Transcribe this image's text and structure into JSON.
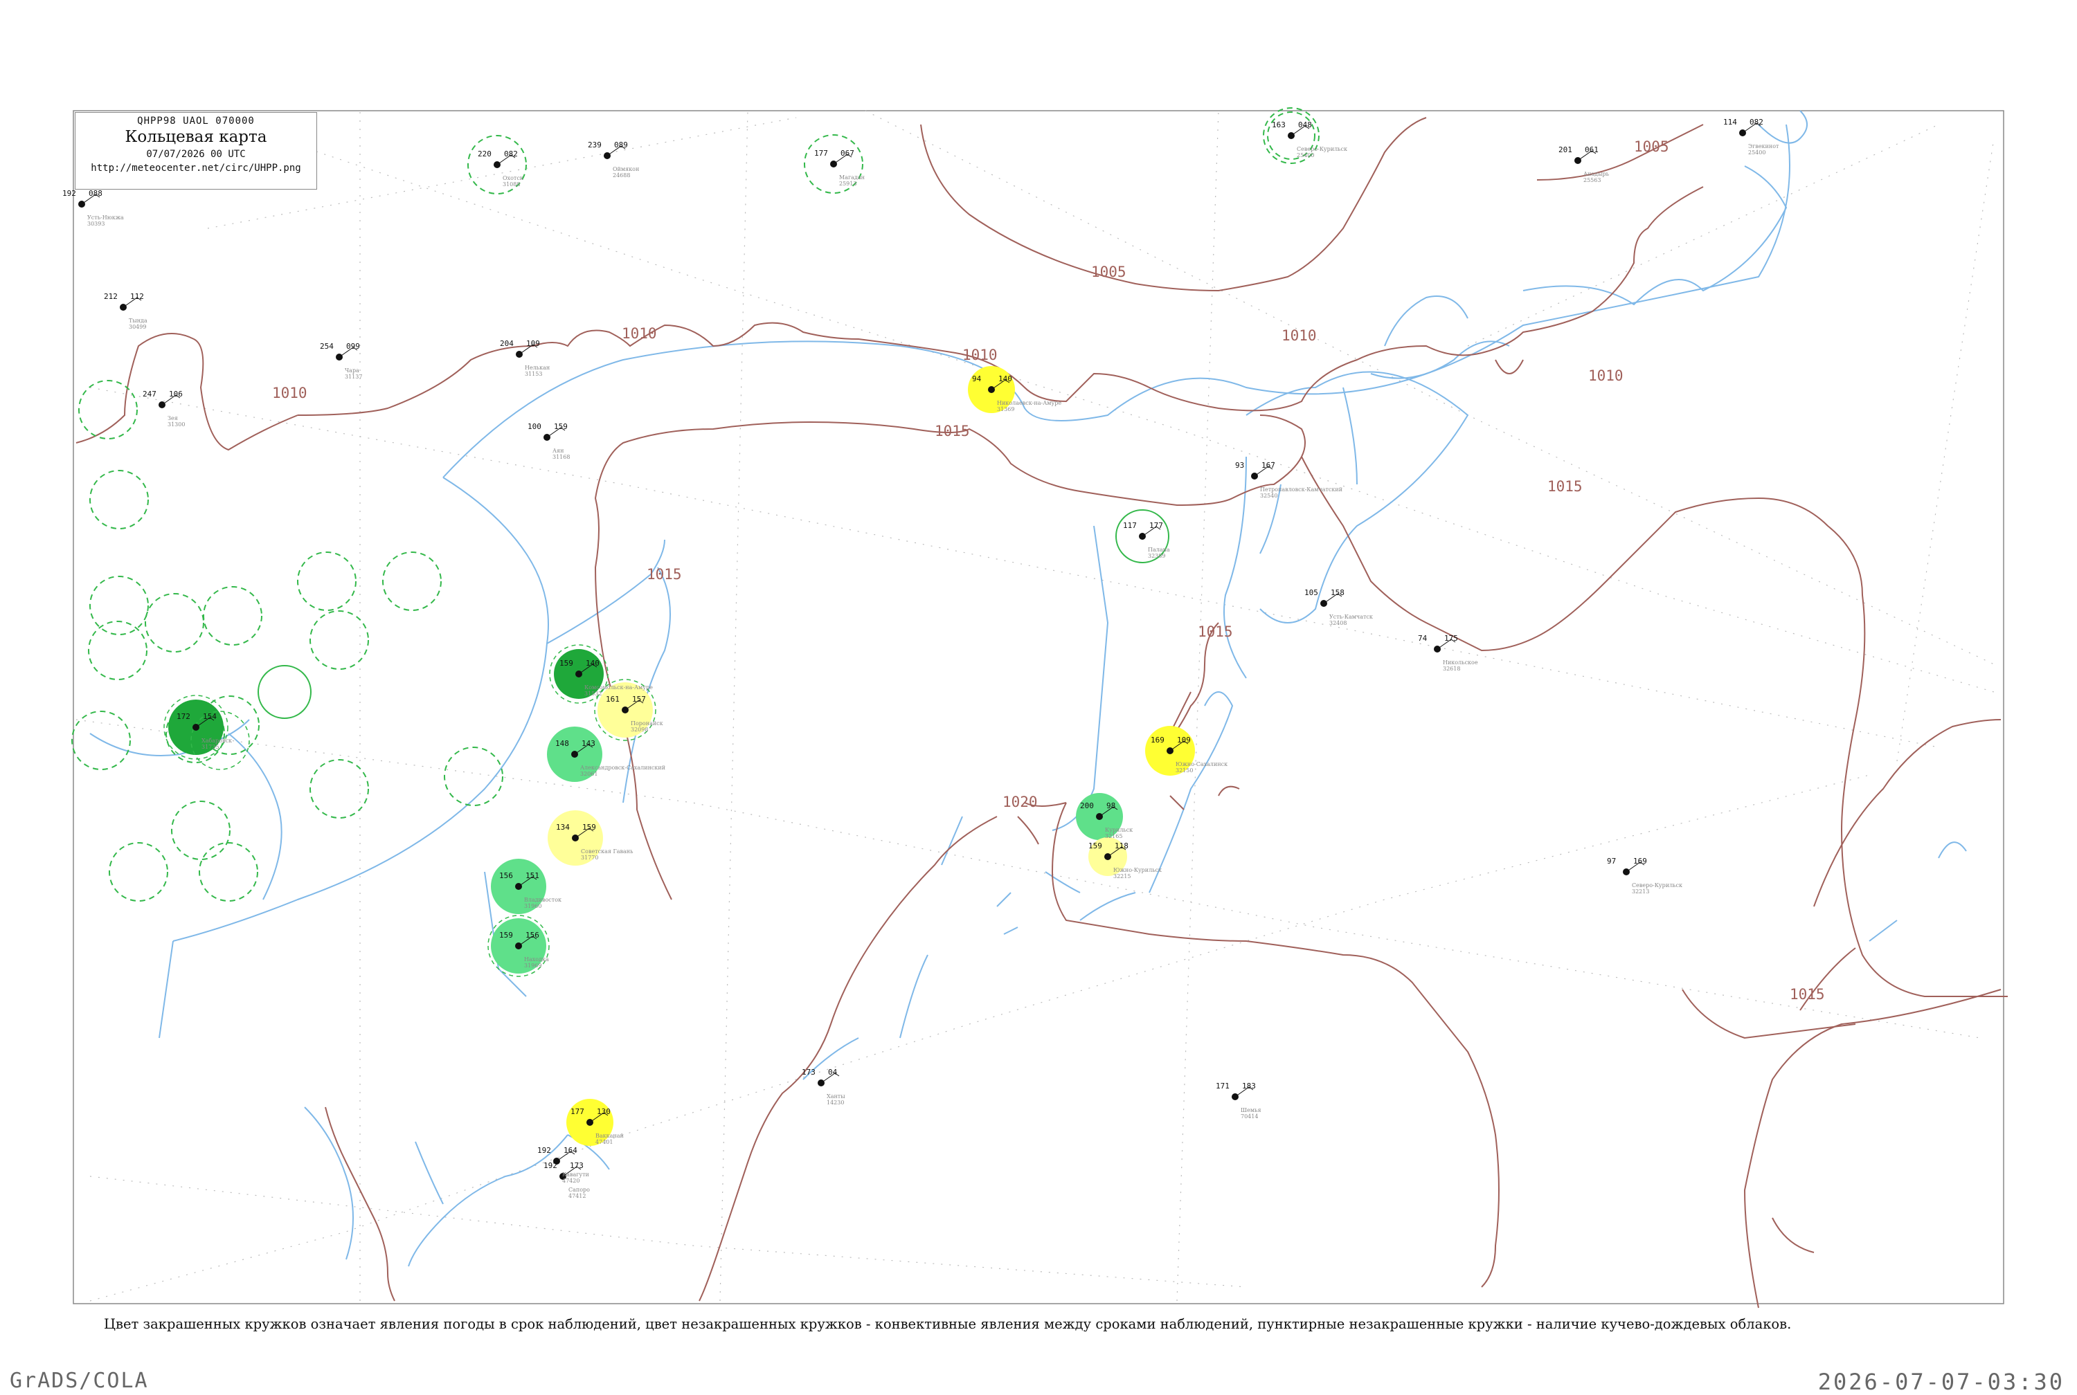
{
  "header": {
    "code": "QHPP98  UAOL  070000",
    "title": "Кольцевая карта",
    "datetime": "07/07/2026 00 UTC",
    "url": "http://meteocenter.net/circ/UHPP.png"
  },
  "caption": "Цвет закрашенных кружков означает явления погоды в срок наблюдений, цвет незакрашенных кружков - конвективные явления между сроками наблюдений, пунктирные незакрашенные кружки - наличие кучево-дождевых облаков.",
  "footer": {
    "left": "GrADS/COLA",
    "right": "2026-07-07-03:30"
  },
  "colors": {
    "isobar": "#a0605a",
    "river": "#7fb8e8",
    "frame": "#888888",
    "circle_dark_green": "#1fa83a",
    "circle_green": "#5fe08a",
    "circle_yellow": "#ffff33",
    "circle_pale_yellow": "#ffff99",
    "circle_dashed": "#33b84a"
  },
  "isobars": [
    {
      "label": "1005"
    },
    {
      "label": "1005"
    },
    {
      "label": "1010"
    },
    {
      "label": "1010"
    },
    {
      "label": "1010"
    },
    {
      "label": "1010"
    },
    {
      "label": "1010"
    },
    {
      "label": "1015"
    },
    {
      "label": "1015"
    },
    {
      "label": "1015"
    },
    {
      "label": "1015"
    },
    {
      "label": "1015"
    },
    {
      "label": "1020"
    }
  ],
  "stations": [
    {
      "name": "Усть-Нюкжа",
      "index": "30393",
      "t": "192",
      "p": "088",
      "type": "plain"
    },
    {
      "name": "Тында",
      "index": "30499",
      "t": "212",
      "p": "112",
      "type": "plain"
    },
    {
      "name": "Чара",
      "index": "31137",
      "t": "254",
      "p": "099",
      "type": "plain"
    },
    {
      "name": "Зея",
      "index": "31300",
      "t": "247",
      "p": "106",
      "type": "plain"
    },
    {
      "name": "Нелькан",
      "index": "31153",
      "t": "204",
      "p": "109",
      "type": "plain"
    },
    {
      "name": "Охотск",
      "index": "31088",
      "t": "220",
      "p": "082",
      "type": "dashed"
    },
    {
      "name": "Магадан",
      "index": "25913",
      "t": "177",
      "p": "067",
      "type": "dashed"
    },
    {
      "name": "Северо-Курильск",
      "index": "25400",
      "t": "163",
      "p": "048",
      "type": "double-dashed"
    },
    {
      "name": "Аян",
      "index": "31168",
      "t": "100",
      "p": "159",
      "type": "plain"
    },
    {
      "name": "Николаевск-на-Амуре",
      "index": "31369",
      "t": "94",
      "p": "140",
      "type": "yellow"
    },
    {
      "name": "Хабаровск",
      "index": "31735",
      "t": "172",
      "p": "154",
      "type": "dark-green"
    },
    {
      "name": "Комсомольск-на-Амуре",
      "index": "31532",
      "t": "159",
      "p": "140",
      "type": "dark-green"
    },
    {
      "name": "Советская Гавань",
      "index": "31770",
      "t": "134",
      "p": "159",
      "type": "pale-yellow"
    },
    {
      "name": "Александровск-Сахалинский",
      "index": "32061",
      "t": "148",
      "p": "143",
      "type": "green"
    },
    {
      "name": "Поронайск",
      "index": "32098",
      "t": "161",
      "p": "157",
      "type": "pale-yellow"
    },
    {
      "name": "Южно-Сахалинск",
      "index": "32150",
      "t": "169",
      "p": "109",
      "type": "yellow"
    },
    {
      "name": "Курильск",
      "index": "32165",
      "t": "200",
      "p": "98",
      "type": "green"
    },
    {
      "name": "Южно-Курильск",
      "index": "32215",
      "t": "159",
      "p": "118",
      "type": "pale-yellow"
    },
    {
      "name": "Владивосток",
      "index": "31960",
      "t": "156",
      "p": "151",
      "type": "green"
    },
    {
      "name": "Находка",
      "index": "31969",
      "t": "159",
      "p": "156",
      "type": "green"
    },
    {
      "name": "Вакканай",
      "index": "47401",
      "t": "177",
      "p": "130",
      "type": "yellow"
    },
    {
      "name": "Оймякон",
      "index": "24688",
      "t": "239",
      "p": "089",
      "type": "plain"
    },
    {
      "name": "Палана",
      "index": "32389",
      "t": "117",
      "p": "177",
      "type": "dashed-green"
    },
    {
      "name": "Петропавловск-Камчатский",
      "index": "32540",
      "t": "93",
      "p": "167",
      "type": "plain"
    },
    {
      "name": "Усть-Камчатск",
      "index": "32408",
      "t": "105",
      "p": "158",
      "type": "plain"
    },
    {
      "name": "Никольское",
      "index": "32618",
      "t": "74",
      "p": "175",
      "type": "plain"
    },
    {
      "name": "Анадырь",
      "index": "25563",
      "t": "201",
      "p": "061",
      "type": "plain"
    },
    {
      "name": "Эгвекинот",
      "index": "25400",
      "t": "114",
      "p": "082",
      "type": "plain"
    },
    {
      "name": "Северо-Курильск",
      "index": "32213",
      "t": "97",
      "p": "169",
      "type": "plain"
    },
    {
      "name": "Сапоро",
      "index": "47412",
      "t": "192",
      "p": "173",
      "type": "plain"
    },
    {
      "name": "Ханты",
      "index": "14230",
      "t": "173",
      "p": "04",
      "type": "plain"
    },
    {
      "name": "Шемья",
      "index": "70414",
      "t": "171",
      "p": "183",
      "type": "plain"
    },
    {
      "name": "Кавагути",
      "index": "47420",
      "t": "192",
      "p": "164",
      "type": "plain"
    }
  ]
}
